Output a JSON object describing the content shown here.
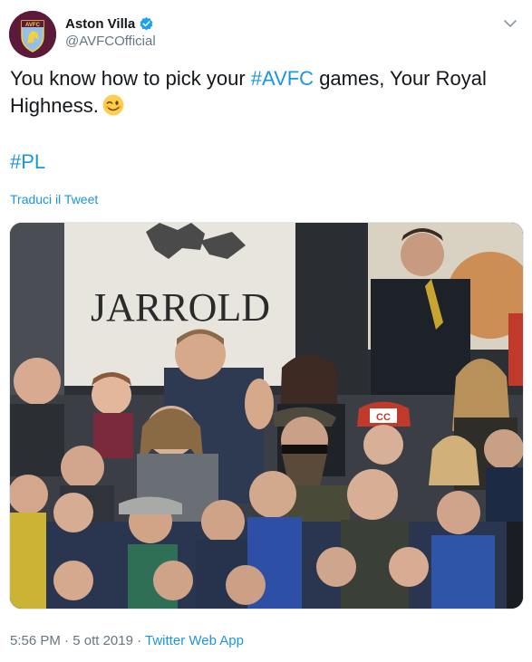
{
  "account": {
    "display_name": "Aston Villa",
    "handle": "@AVFCOfficial",
    "avatar_text": "AVFC",
    "verified": true
  },
  "tweet": {
    "text_before": "You know how to pick your ",
    "hashtag_1": "#AVFC",
    "text_after": " games, Your Royal Highness.",
    "emoji": "winking-face",
    "hashtag_2": "#PL",
    "translate_link": "Traduci il Tweet"
  },
  "photo": {
    "banner_text": "JARROLD",
    "cap_text": "CC"
  },
  "meta": {
    "time": "5:56 PM",
    "separator_1": " · ",
    "date": "5 ott 2019",
    "separator_2": " · ",
    "app": "Twitter Web App"
  },
  "colors": {
    "link": "#1b95e0",
    "secondary_text": "#657786",
    "avatar_bg": "#5c1a3a"
  }
}
